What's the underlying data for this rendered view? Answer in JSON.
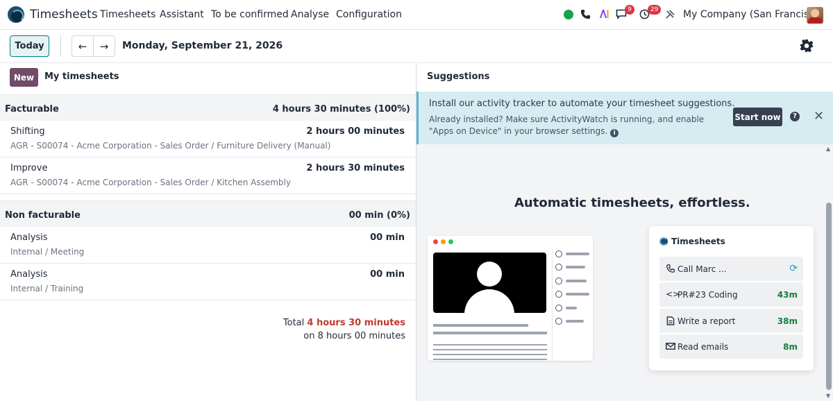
{
  "navbar": {
    "app_title": "Timesheets",
    "menu": [
      "Timesheets",
      "Assistant",
      "To be confirmed",
      "Analyse",
      "Configuration"
    ],
    "messages_count": "9",
    "activities_count": "29",
    "company": "My Company (San Francisco)"
  },
  "control": {
    "today_label": "Today",
    "prev_arrow": "←",
    "next_arrow": "→",
    "date": "Monday, September 21, 2026"
  },
  "left": {
    "new_label": "New",
    "header": "My timesheets",
    "sections": [
      {
        "name": "Facturable",
        "amount": "4 hours 30 minutes (100%)",
        "rows": [
          {
            "title": "Shifting",
            "sub": "AGR - S00074 - Acme Corporation - Sales Order / Furniture Delivery (Manual)",
            "dur": "2 hours 00 minutes"
          },
          {
            "title": "Improve",
            "sub": "AGR - S00074 - Acme Corporation - Sales Order / Kitchen Assembly",
            "dur": "2 hours 30 minutes"
          }
        ]
      },
      {
        "name": "Non facturable",
        "amount": "00 min (0%)",
        "rows": [
          {
            "title": "Analysis",
            "sub": "Internal / Meeting",
            "dur": "00 min"
          },
          {
            "title": "Analysis",
            "sub": "Internal / Training",
            "dur": "00 min"
          }
        ]
      }
    ],
    "total_label": "Total",
    "total_hours": "4 hours 30 minutes",
    "total_on": "on 8 hours 00 minutes"
  },
  "right": {
    "title": "Suggestions",
    "banner": {
      "title": "Install our activity tracker to automate your timesheet suggestions.",
      "text": "Already installed? Make sure ActivityWatch is running, and enable \"Apps on Device\" in your browser settings.",
      "start_label": "Start now",
      "help_glyph": "?",
      "close_glyph": "✕"
    },
    "promo_title": "Automatic timesheets, effortless.",
    "card": {
      "title": "Timesheets",
      "items": [
        {
          "icon": "phone-icon",
          "glyph": "📞",
          "label": "Call Marc ...",
          "value": ""
        },
        {
          "icon": "code-icon",
          "glyph": "<>",
          "label": "PR#23 Coding",
          "value": "43m"
        },
        {
          "icon": "document-icon",
          "glyph": "▤",
          "label": "Write a report",
          "value": "38m"
        },
        {
          "icon": "envelope-icon",
          "glyph": "✉",
          "label": "Read emails",
          "value": "8m"
        }
      ]
    }
  },
  "colors": {
    "brand": "#714b67",
    "accent": "#017e84",
    "banner_bg": "#d6ecf1",
    "total_red": "#c0392b",
    "value_green": "#15803d"
  }
}
